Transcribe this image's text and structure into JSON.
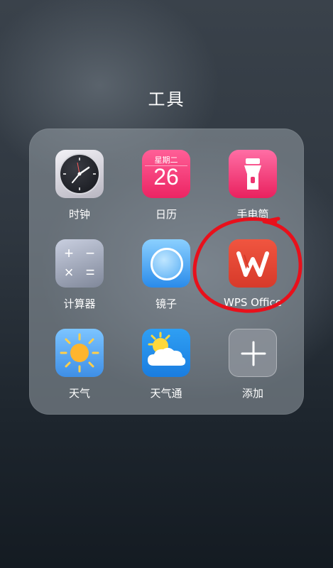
{
  "folder": {
    "title": "工具"
  },
  "apps": [
    {
      "label": "时钟",
      "icon": "clock-icon"
    },
    {
      "label": "日历",
      "icon": "calendar-icon",
      "weekday": "星期二",
      "date": "26"
    },
    {
      "label": "手电筒",
      "icon": "flashlight-icon"
    },
    {
      "label": "计算器",
      "icon": "calculator-icon"
    },
    {
      "label": "镜子",
      "icon": "mirror-icon"
    },
    {
      "label": "WPS Office",
      "icon": "wps-office-icon"
    },
    {
      "label": "天气",
      "icon": "weather-sun-icon"
    },
    {
      "label": "天气通",
      "icon": "weather-cloud-sun-icon"
    },
    {
      "label": "添加",
      "icon": "plus-icon"
    }
  ],
  "calculator_symbols": [
    "+",
    "−",
    "×",
    "="
  ],
  "annotation_color": "#e8101b"
}
